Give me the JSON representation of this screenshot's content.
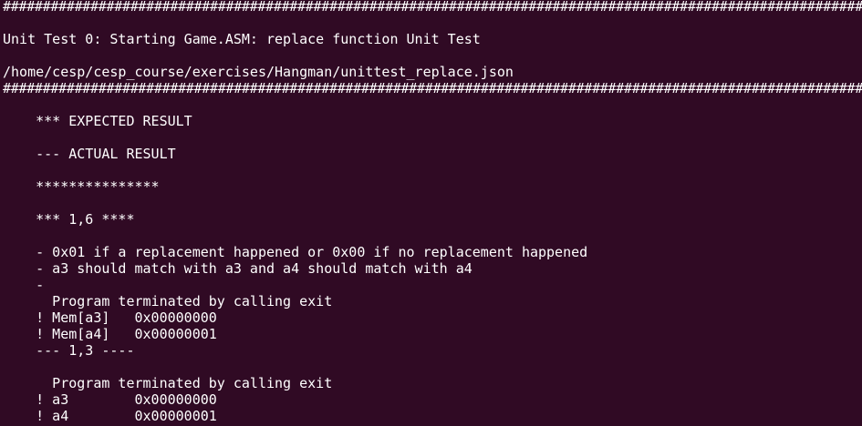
{
  "terminal": {
    "lines": [
      "##############################################################################################################",
      "",
      "Unit Test 0: Starting Game.ASM: replace function Unit Test",
      "",
      "/home/cesp/cesp_course/exercises/Hangman/unittest_replace.json",
      "##############################################################################################################",
      "",
      "    *** EXPECTED RESULT",
      "",
      "    --- ACTUAL RESULT",
      "",
      "    ***************",
      "",
      "    *** 1,6 ****",
      "",
      "    - 0x01 if a replacement happened or 0x00 if no replacement happened",
      "    - a3 should match with a3 and a4 should match with a4",
      "    -",
      "      Program terminated by calling exit",
      "    ! Mem[a3]   0x00000000",
      "    ! Mem[a4]   0x00000001",
      "    --- 1,3 ----",
      "",
      "      Program terminated by calling exit",
      "    ! a3        0x00000000",
      "    ! a4        0x00000001"
    ]
  }
}
